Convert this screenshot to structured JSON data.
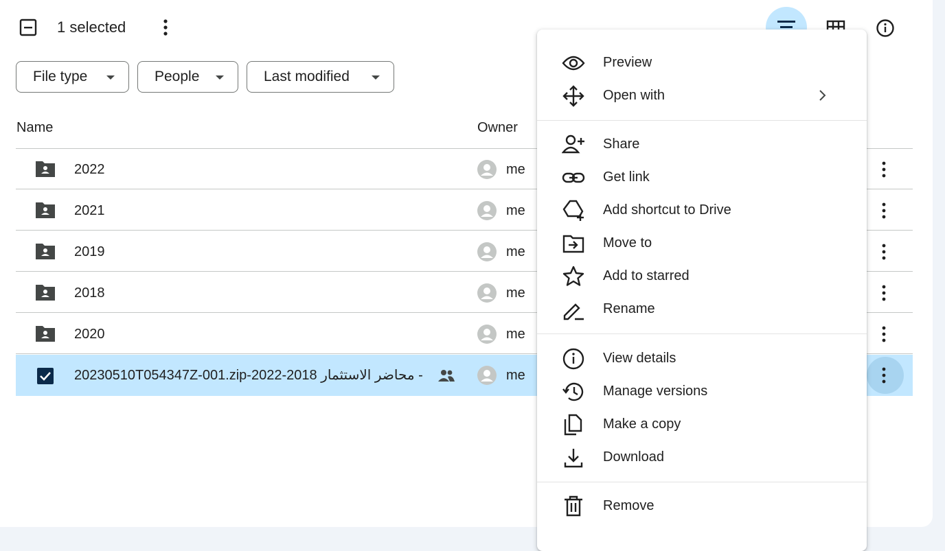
{
  "toolbar": {
    "selection_count": "1 selected",
    "icons": [
      "select-partial-icon",
      "more-vert-icon",
      "list-view-icon",
      "grid-view-icon",
      "info-icon"
    ]
  },
  "filters": {
    "file_type": "File type",
    "people": "People",
    "last_modified": "Last modified"
  },
  "table": {
    "columns": [
      "Name",
      "Owner"
    ],
    "rows": [
      {
        "name": "2022",
        "owner": "me",
        "type": "shared-folder"
      },
      {
        "name": "2021",
        "owner": "me",
        "type": "shared-folder"
      },
      {
        "name": "2019",
        "owner": "me",
        "type": "shared-folder"
      },
      {
        "name": "2018",
        "owner": "me",
        "type": "shared-folder"
      },
      {
        "name": "2020",
        "owner": "me",
        "type": "shared-folder"
      },
      {
        "name": "20230510T054347Z-001.zip-محاضر الاستثمار 2018-2022 -",
        "owner": "me",
        "type": "zip",
        "selected": true,
        "shared": true
      }
    ]
  },
  "context_menu": {
    "items": [
      {
        "label": "Preview",
        "icon": "eye-icon"
      },
      {
        "label": "Open with",
        "icon": "move-arrows-icon",
        "submenu": true
      },
      {
        "label": "Share",
        "icon": "person-add-icon"
      },
      {
        "label": "Get link",
        "icon": "link-icon"
      },
      {
        "label": "Add shortcut to Drive",
        "icon": "drive-shortcut-icon"
      },
      {
        "label": "Move to",
        "icon": "folder-move-icon"
      },
      {
        "label": "Add to starred",
        "icon": "star-icon"
      },
      {
        "label": "Rename",
        "icon": "pencil-icon"
      },
      {
        "label": "View details",
        "icon": "info-icon"
      },
      {
        "label": "Manage versions",
        "icon": "history-icon"
      },
      {
        "label": "Make a copy",
        "icon": "copy-icon"
      },
      {
        "label": "Download",
        "icon": "download-icon"
      },
      {
        "label": "Remove",
        "icon": "trash-icon"
      }
    ]
  },
  "colors": {
    "selected_row": "#c2e7ff",
    "active_view_button": "#c2e7ff",
    "checkbox": "#0b2a4a",
    "text": "#1f1f1f"
  }
}
